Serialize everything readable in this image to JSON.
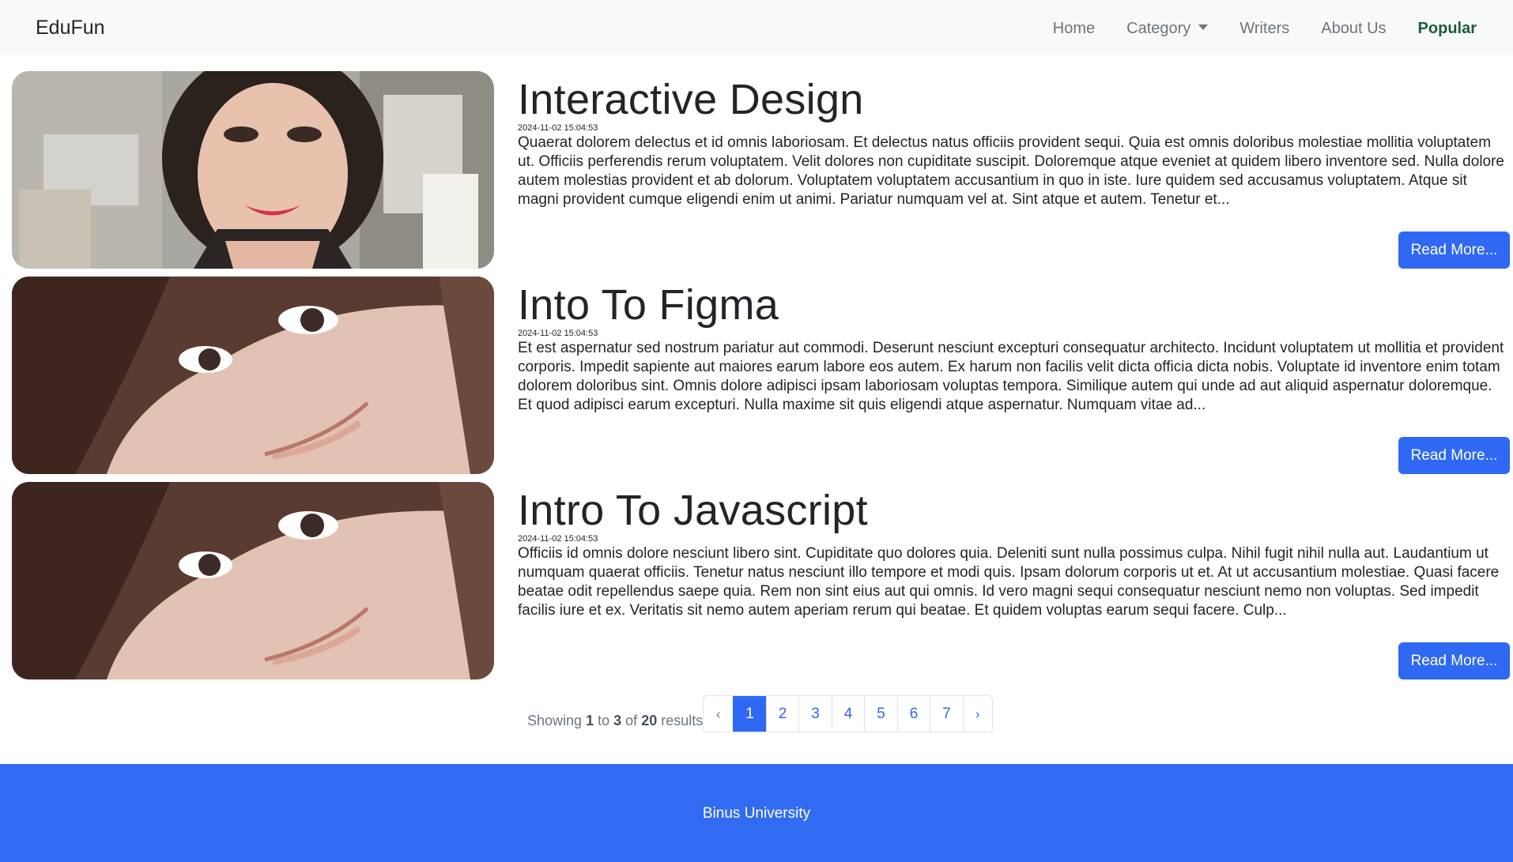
{
  "navbar": {
    "brand": "EduFun",
    "links": [
      {
        "label": "Home"
      },
      {
        "label": "Category"
      },
      {
        "label": "Writers"
      },
      {
        "label": "About Us"
      },
      {
        "label": "Popular"
      }
    ],
    "active": "Popular"
  },
  "articles": [
    {
      "title": "Interactive Design",
      "date": "2024-11-02 15:04:53",
      "body": "Quaerat dolorem delectus et id omnis laboriosam. Et delectus natus officiis provident sequi. Quia est omnis doloribus molestiae mollitia voluptatem ut. Officiis perferendis rerum voluptatem. Velit dolores non cupiditate suscipit. Doloremque atque eveniet at quidem libero inventore sed. Nulla dolore autem molestias provident et ab dolorum. Voluptatem voluptatem accusantium in quo in iste. Iure quidem sed accusamus voluptatem. Atque sit magni provident cumque eligendi enim ut animi. Pariatur numquam vel at. Sint atque et autem. Tenetur et...",
      "button": "Read More..."
    },
    {
      "title": "Into To Figma",
      "date": "2024-11-02 15:04:53",
      "body": "Et est aspernatur sed nostrum pariatur aut commodi. Deserunt nesciunt excepturi consequatur architecto. Incidunt voluptatem ut mollitia et provident corporis. Impedit sapiente aut maiores earum labore eos autem. Ex harum non facilis velit dicta officia dicta nobis. Voluptate id inventore enim totam dolorem doloribus sint. Omnis dolore adipisci ipsam laboriosam voluptas tempora. Similique autem qui unde ad aut aliquid aspernatur doloremque. Et quod adipisci earum excepturi. Nulla maxime sit quis eligendi atque aspernatur. Numquam vitae ad...",
      "button": "Read More..."
    },
    {
      "title": "Intro To Javascript",
      "date": "2024-11-02 15:04:53",
      "body": "Officiis id omnis dolore nesciunt libero sint. Cupiditate quo dolores quia. Deleniti sunt nulla possimus culpa. Nihil fugit nihil nulla aut. Laudantium ut numquam quaerat officiis. Tenetur natus nesciunt illo tempore et modi quis. Ipsam dolorum corporis ut et. At ut accusantium molestiae. Quasi facere beatae odit repellendus saepe quia. Rem non sint eius aut qui omnis. Id vero magni sequi consequatur nesciunt nemo non voluptas. Sed impedit facilis iure et ex. Veritatis sit nemo autem aperiam rerum qui beatae. Et quidem voluptas earum sequi facere. Culp...",
      "button": "Read More..."
    }
  ],
  "pagination": {
    "showing_prefix": "Showing",
    "from": "1",
    "to_word": "to",
    "to": "3",
    "of_word": "of",
    "total": "20",
    "results_word": "results",
    "prev": "‹",
    "next": "›",
    "pages": [
      "1",
      "2",
      "3",
      "4",
      "5",
      "6",
      "7"
    ],
    "current": "1"
  },
  "footer": {
    "text": "Binus University"
  },
  "colors": {
    "primary": "#2f69f3",
    "footer_bg": "#316bf2",
    "navbar_bg": "#f8f9fa",
    "active_link": "#1e5d3a"
  }
}
